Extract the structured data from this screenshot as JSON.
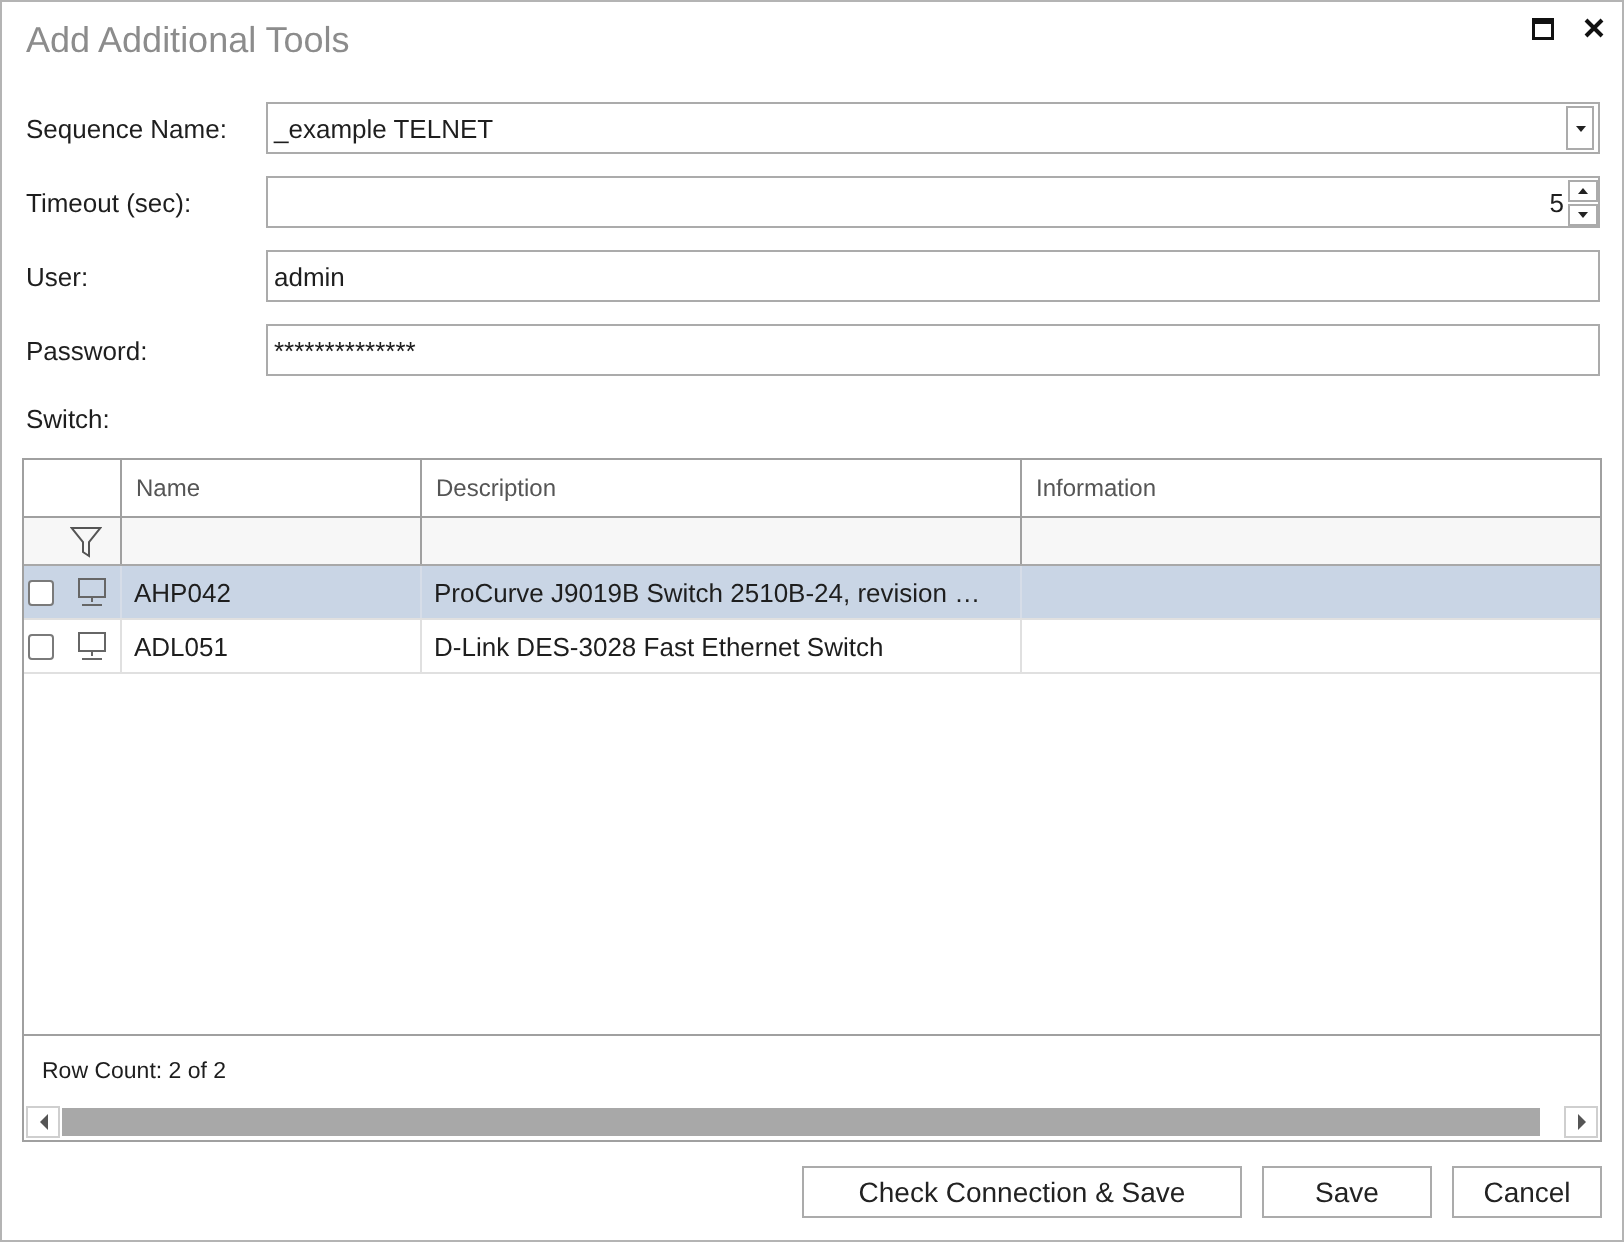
{
  "window": {
    "title": "Add Additional Tools"
  },
  "form": {
    "fields": [
      {
        "kind": "dropdown",
        "label": "Sequence Name:",
        "value": "_example TELNET"
      },
      {
        "kind": "spinner",
        "label": "Timeout (sec):",
        "value": "5"
      },
      {
        "kind": "text",
        "label": "User:",
        "value": "admin"
      },
      {
        "kind": "text",
        "label": "Password:",
        "value": "**************"
      }
    ]
  },
  "switch_label": "Switch:",
  "table": {
    "columns": [
      "Name",
      "Description",
      "Information"
    ],
    "rows": [
      {
        "selected": true,
        "checked": false,
        "cells": [
          "AHP042",
          "ProCurve J9019B Switch 2510B-24, revision …"
        ]
      },
      {
        "selected": false,
        "checked": false,
        "cells": [
          "ADL051",
          "D-Link DES-3028 Fast Ethernet Switch"
        ]
      }
    ],
    "row_count": "Row Count: 2 of 2"
  },
  "buttons": [
    "Check Connection & Save",
    "Save",
    "Cancel"
  ]
}
